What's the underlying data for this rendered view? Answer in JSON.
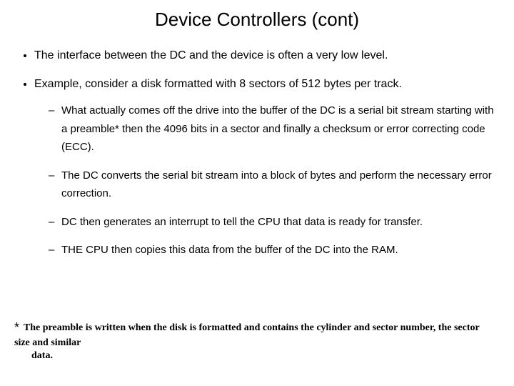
{
  "title": "Device Controllers (cont)",
  "bullets": {
    "b1": "The interface between the DC and the device is often a very low level.",
    "b2": "Example, consider a disk formatted with 8 sectors of 512 bytes per track.",
    "sub": {
      "s1": "What actually comes off the drive into the buffer of the DC is a serial bit stream starting with a preamble*  then the 4096 bits in a sector and finally a checksum or error correcting code (ECC).",
      "s2": "The DC converts the serial bit stream into a block of bytes and perform the necessary error correction.",
      "s3": "DC then generates an interrupt to tell the CPU that data is ready for transfer.",
      "s4": "THE CPU  then copies this data  from the buffer of the DC into the RAM."
    }
  },
  "footnote": {
    "star": "*",
    "line1": "The preamble is written when the disk is formatted and contains the cylinder and sector number, the sector size and similar",
    "line2": "data."
  }
}
